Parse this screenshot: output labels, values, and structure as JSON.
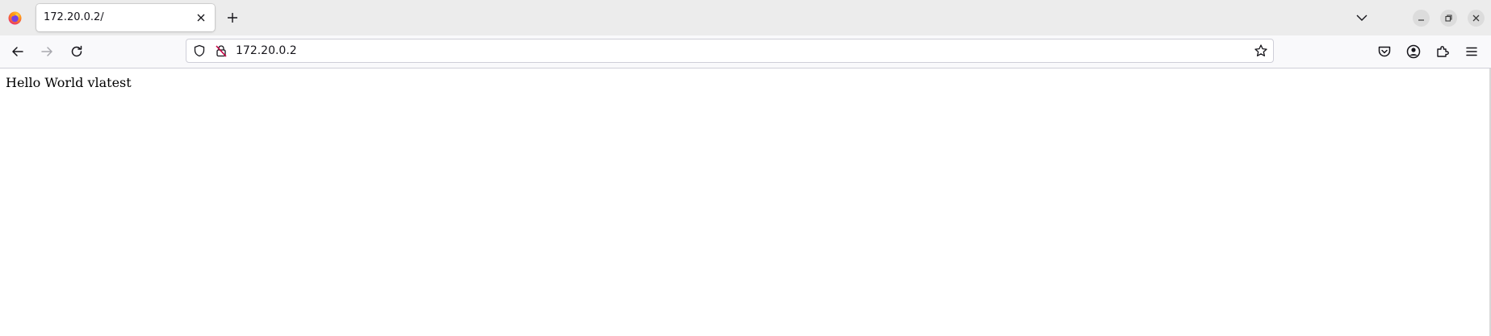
{
  "browser": {
    "tab": {
      "title": "172.20.0.2/"
    },
    "address_bar": {
      "url": "172.20.0.2"
    },
    "colors": {
      "tabstrip_bg": "#ececec",
      "toolbar_bg": "#f9f9fb",
      "icon": "#15141a",
      "icon_disabled": "#a8a8ae",
      "insecure_lock": "#c50042"
    },
    "icons": {
      "logo": "firefox-logo-icon",
      "tab_close": "close-icon",
      "new_tab": "plus-icon",
      "list_all_tabs": "chevron-down-icon",
      "minimize": "minimize-icon",
      "restore": "restore-icon",
      "close_window": "close-icon",
      "back": "arrow-left-icon",
      "forward": "arrow-right-icon",
      "reload": "reload-icon",
      "tracking_protection": "shield-icon",
      "connection": "insecure-lock-icon",
      "bookmark": "star-icon",
      "pocket": "pocket-icon",
      "account": "account-icon",
      "extensions": "puzzle-icon",
      "menu": "hamburger-menu-icon"
    }
  },
  "page": {
    "body_text": "Hello World vlatest"
  }
}
